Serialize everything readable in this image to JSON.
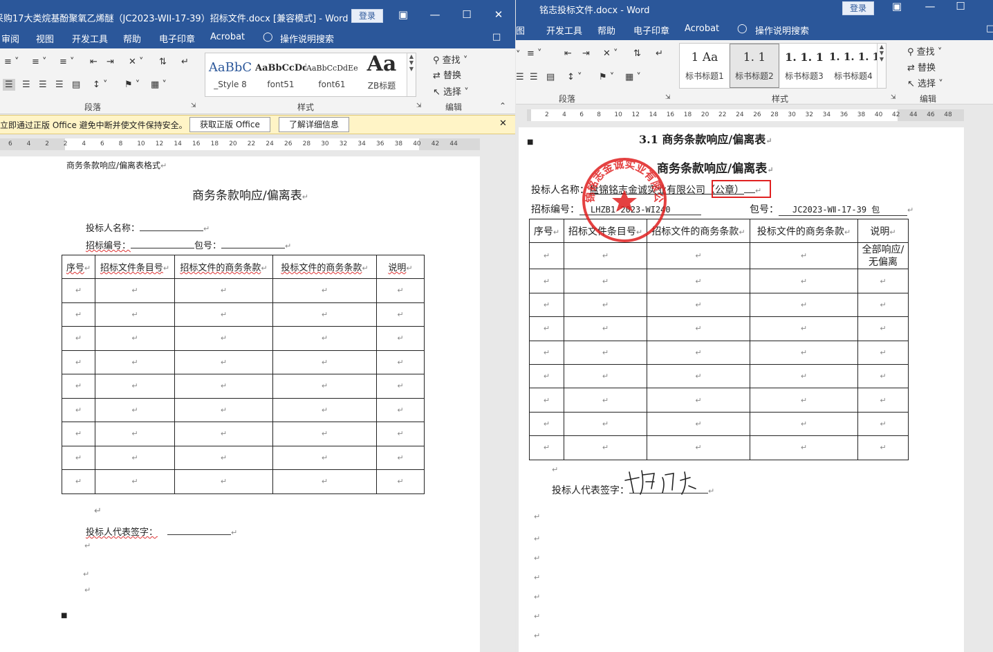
{
  "left": {
    "title": "采购17大类烷基酚聚氧乙烯醚（JC2023-WII-17-39）招标文件.docx [兼容模式] - Word",
    "login": "登录",
    "menu": [
      "审阅",
      "视图",
      "开发工具",
      "帮助",
      "电子印章",
      "Acrobat"
    ],
    "search_label": "操作说明搜索",
    "groups": {
      "paragraph": "段落",
      "styles": "样式",
      "editing": "编辑"
    },
    "styles": [
      {
        "sample": "AaBbC",
        "name": "_Style 8"
      },
      {
        "sample": "AaBbCcDd",
        "name": "font51"
      },
      {
        "sample": "AaBbCcDdEe",
        "name": "font61"
      },
      {
        "sample": "Aa",
        "name": "ZB标题"
      }
    ],
    "editing": {
      "find": "查找",
      "replace": "替换",
      "select": "选择"
    },
    "message": {
      "text": "立即通过正版 Office 避免中断并使文件保持安全。",
      "btn_get": "获取正版 Office",
      "btn_more": "了解详细信息"
    },
    "ruler": [
      "6",
      "4",
      "2",
      "2",
      "4",
      "6",
      "8",
      "10",
      "12",
      "14",
      "16",
      "18",
      "20",
      "22",
      "24",
      "26",
      "28",
      "30",
      "32",
      "34",
      "36",
      "38",
      "40",
      "42",
      "44"
    ],
    "doc": {
      "header_note": "商务条款响应/偏离表格式",
      "title": "商务条款响应/偏离表",
      "bidder_label": "投标人名称：",
      "bid_no_label": "招标编号：",
      "package_label": "包号：",
      "columns": [
        "序号",
        "招标文件条目号",
        "招标文件的商务条款",
        "投标文件的商务条款",
        "说明"
      ],
      "rows": 9,
      "sign_label": "投标人代表签字："
    }
  },
  "right": {
    "title": "铭志投标文件.docx - Word",
    "login": "登录",
    "menu": [
      "图",
      "开发工具",
      "帮助",
      "电子印章",
      "Acrobat"
    ],
    "search_label": "操作说明搜索",
    "groups": {
      "paragraph": "段落",
      "styles": "样式",
      "editing": "编辑"
    },
    "styles": [
      {
        "sample": "1  Aa",
        "name": "标书标题1"
      },
      {
        "sample": "1. 1",
        "name": "标书标题2"
      },
      {
        "sample": "1. 1. 1",
        "name": "标书标题3"
      },
      {
        "sample": "1. 1. 1. 1",
        "name": "标书标题4"
      }
    ],
    "editing": {
      "find": "查找",
      "replace": "替换",
      "select": "选择"
    },
    "ruler": [
      "2",
      "4",
      "6",
      "8",
      "10",
      "12",
      "14",
      "16",
      "18",
      "20",
      "22",
      "24",
      "26",
      "28",
      "30",
      "32",
      "34",
      "36",
      "38",
      "40",
      "42",
      "44",
      "46",
      "48"
    ],
    "doc": {
      "section_heading": "3.1    商务条款响应/偏离表",
      "title": "商务条款响应/偏离表",
      "bidder_label": "投标人名称：",
      "bidder_name": "盘锦铭志金诚实业有限公司",
      "seal_mark": "（公章）",
      "bid_no_label": "招标编号：",
      "bid_no": "LHZB1-2023-WI240",
      "package_label": "包号：",
      "package_no": "JC2023-WⅡ-17-39 包",
      "columns": [
        "序号",
        "招标文件条目号",
        "招标文件的商务条款",
        "投标文件的商务条款",
        "说明"
      ],
      "first_row_note": "全部响应/无偏离",
      "rows": 9,
      "sign_label": "投标人代表签字：",
      "signature": "杨丽石",
      "stamp_text": "盘锦铭志金诚实业有限公司"
    }
  },
  "colors": {
    "word_blue": "#2b579a",
    "message_bar": "#fff4c6",
    "stamp_red": "#e02020",
    "highlight_box": "#e02020"
  }
}
